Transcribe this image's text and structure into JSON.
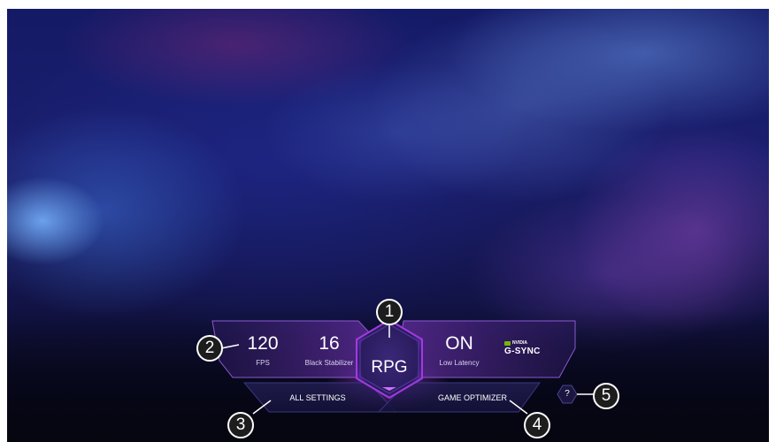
{
  "hud": {
    "fps": {
      "value": "120",
      "label": "FPS"
    },
    "black_stabilizer": {
      "value": "16",
      "label": "Black Stabilizer"
    },
    "genre": "RPG",
    "low_latency": {
      "value": "ON",
      "label": "Low Latency"
    },
    "gsync": {
      "brand": "NVIDIA",
      "label": "G-SYNC"
    }
  },
  "buttons": {
    "all_settings": "ALL SETTINGS",
    "game_optimizer": "GAME OPTIMIZER",
    "help": "?"
  },
  "markers": [
    "1",
    "2",
    "3",
    "4",
    "5"
  ],
  "colors": {
    "accent": "#8c2fc4",
    "panel": "#3a1f6e",
    "gsync_green": "#76b900"
  }
}
